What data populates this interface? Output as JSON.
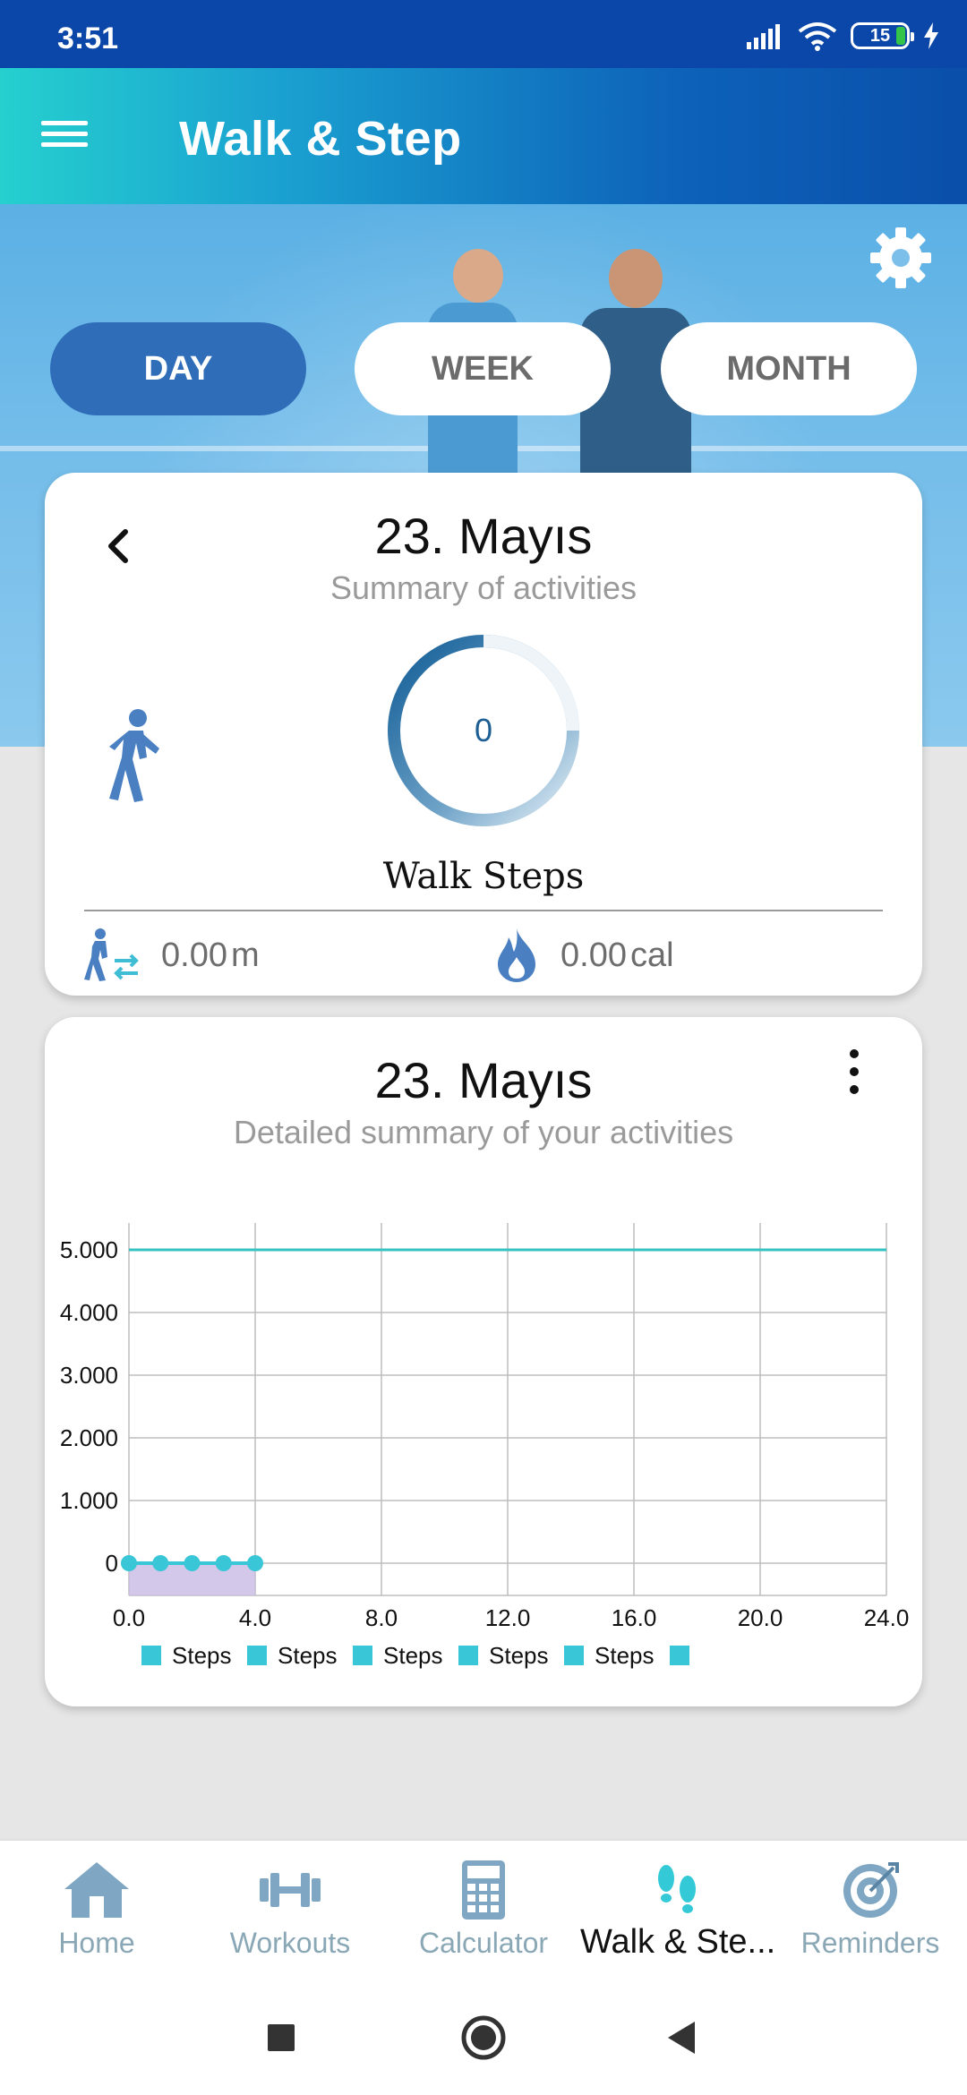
{
  "status": {
    "time": "3:51",
    "battery": "15"
  },
  "app": {
    "title": "Walk & Step"
  },
  "tabs": [
    {
      "label": "DAY",
      "active": true
    },
    {
      "label": "WEEK",
      "active": false
    },
    {
      "label": "MONTH",
      "active": false
    }
  ],
  "summary_card": {
    "date": "23. Mayıs",
    "subtitle": "Summary of activities",
    "steps_value": "0",
    "steps_label": "Walk Steps",
    "distance_value": "0.00",
    "distance_unit": "m",
    "calories_value": "0.00",
    "calories_unit": "cal"
  },
  "detail_card": {
    "date": "23. Mayıs",
    "subtitle": "Detailed summary of your activities"
  },
  "chart_data": {
    "type": "line",
    "title": "",
    "xlabel": "",
    "ylabel": "",
    "x_ticks": [
      "0.0",
      "4.0",
      "8.0",
      "12.0",
      "16.0",
      "20.0",
      "24.0"
    ],
    "y_ticks": [
      "0",
      "1.000",
      "2.000",
      "3.000",
      "4.000",
      "5.000"
    ],
    "xlim": [
      0,
      24
    ],
    "ylim": [
      0,
      5000
    ],
    "goal_line": 5000,
    "series": [
      {
        "name": "Steps",
        "x": [
          0,
          1,
          2,
          3,
          4
        ],
        "values": [
          0,
          0,
          0,
          0,
          0
        ]
      }
    ],
    "legend": [
      "Steps",
      "Steps",
      "Steps",
      "Steps",
      "Steps",
      ""
    ],
    "legend_position": "bottom",
    "grid": true,
    "colors": {
      "line": "#39c6d6",
      "goal": "#35c2c2",
      "area": "#cbbde6",
      "grid": "#bdbdbd"
    }
  },
  "bottom_nav": [
    {
      "label": "Home",
      "icon": "home-icon"
    },
    {
      "label": "Workouts",
      "icon": "dumbbell-icon"
    },
    {
      "label": "Calculator",
      "icon": "calculator-icon"
    },
    {
      "label": "Walk & Ste...",
      "icon": "footsteps-icon",
      "active": true
    },
    {
      "label": "Reminders",
      "icon": "target-icon"
    }
  ]
}
